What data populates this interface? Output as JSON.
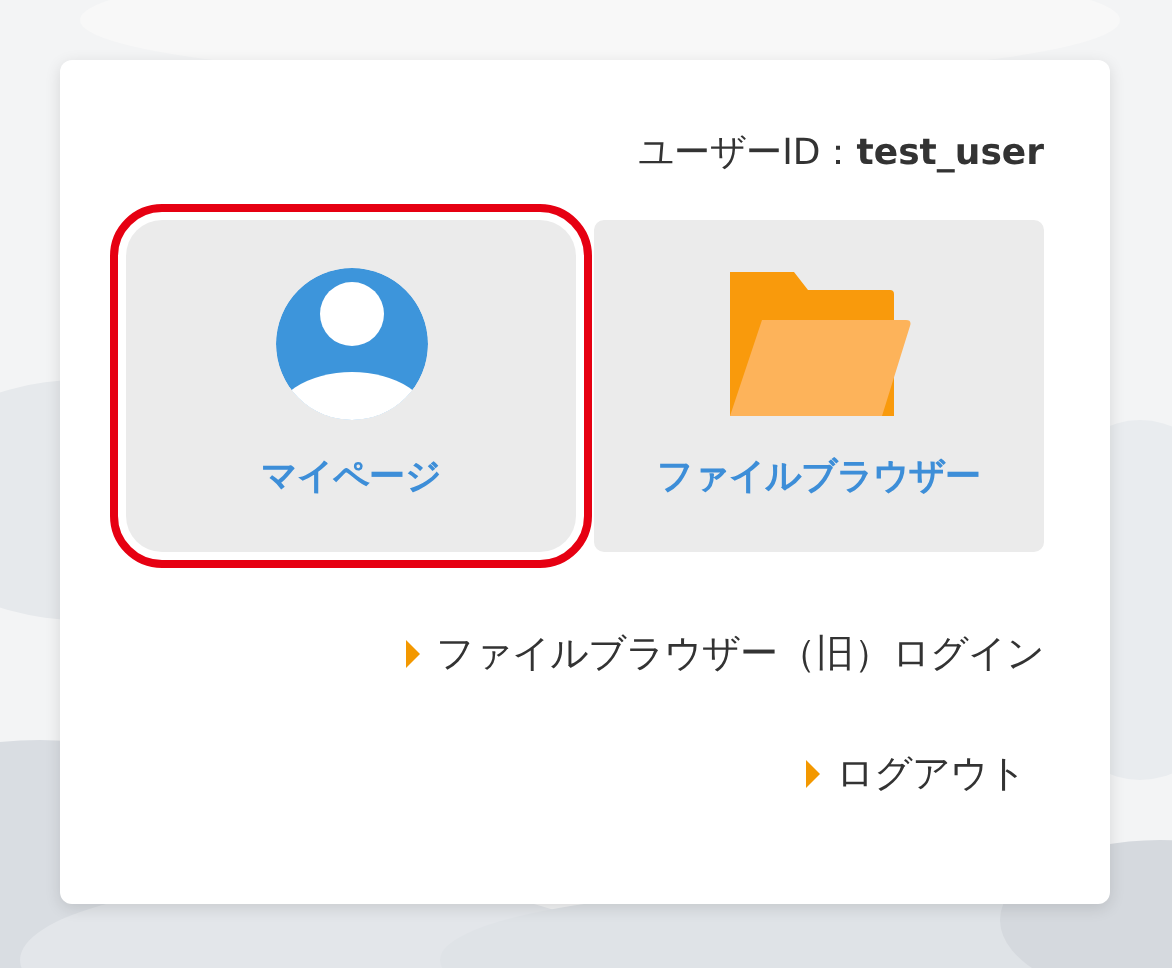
{
  "user_id": "ユーザーID：**test_user**",
  "tiles": [
    {
      "kind": "person",
      "label": "マイページ",
      "selected": true
    },
    {
      "kind": "folder",
      "label": "ファイルブラウザー",
      "selected": false
    }
  ],
  "links": [
    {
      "label": "ファイルブラウザー（旧）ログイン"
    },
    {
      "label": "ログアウト"
    }
  ]
}
